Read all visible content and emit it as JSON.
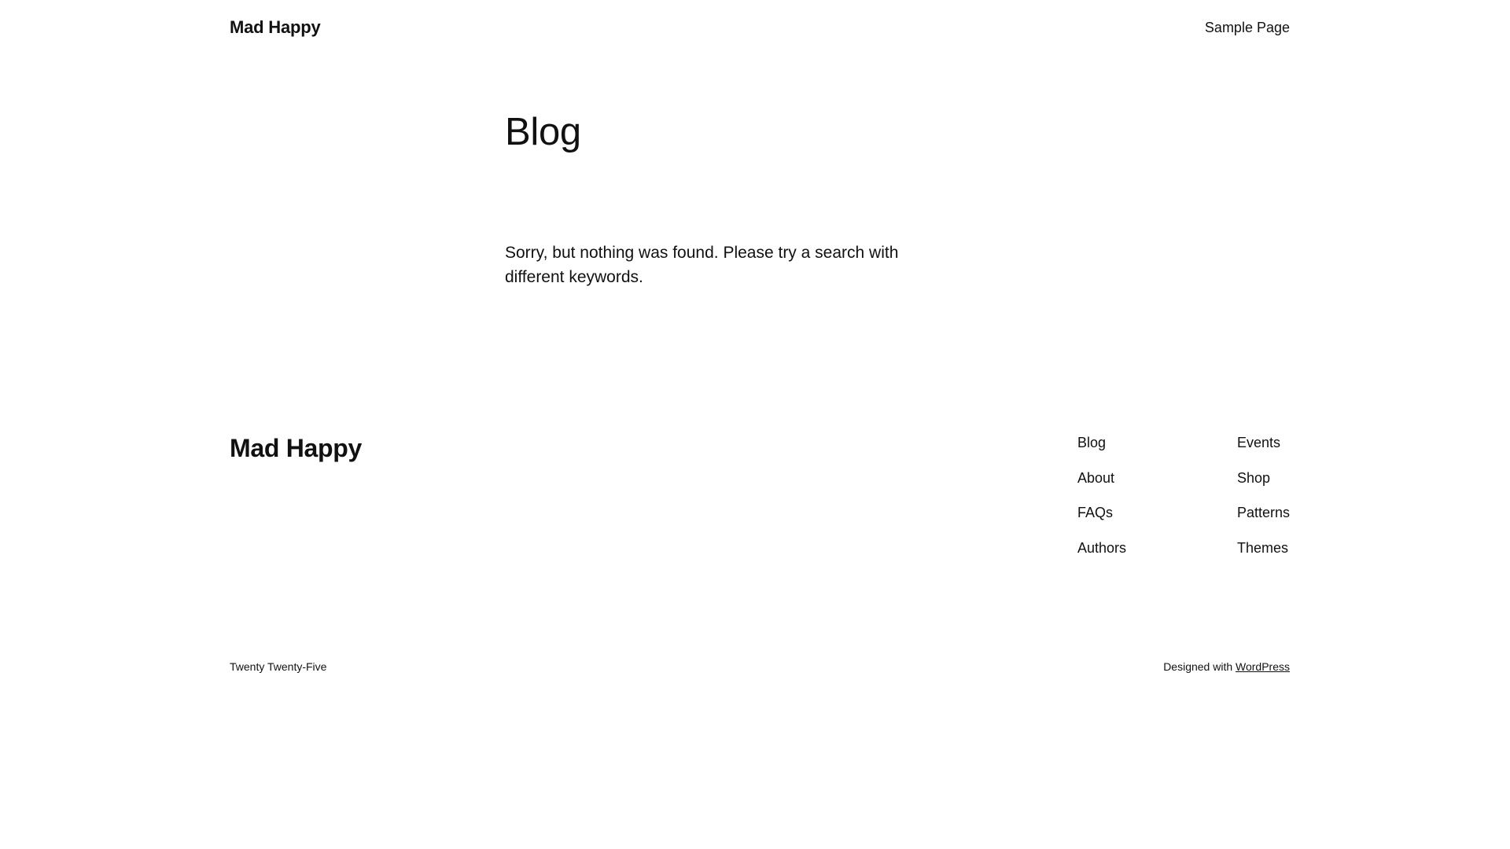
{
  "header": {
    "site_title": "Mad Happy",
    "nav": [
      {
        "label": "Sample Page"
      }
    ]
  },
  "main": {
    "title": "Blog",
    "message": "Sorry, but nothing was found. Please try a search with different keywords."
  },
  "footer": {
    "site_title": "Mad Happy",
    "nav_col1": [
      {
        "label": "Blog"
      },
      {
        "label": "About"
      },
      {
        "label": "FAQs"
      },
      {
        "label": "Authors"
      }
    ],
    "nav_col2": [
      {
        "label": "Events"
      },
      {
        "label": "Shop"
      },
      {
        "label": "Patterns"
      },
      {
        "label": "Themes"
      }
    ],
    "theme_name": "Twenty Twenty-Five",
    "credit_prefix": "Designed with",
    "credit_link": "WordPress"
  }
}
